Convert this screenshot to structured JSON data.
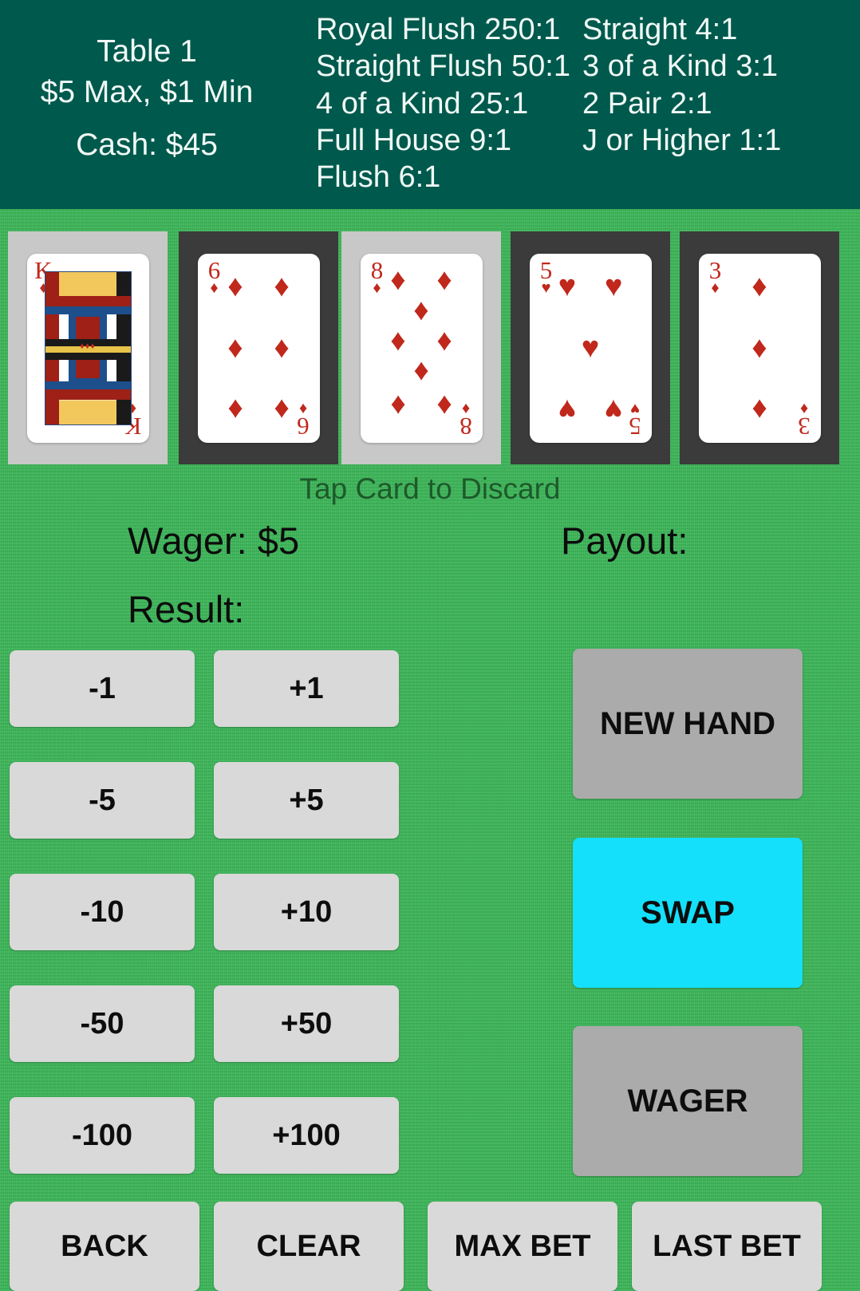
{
  "header": {
    "table_name": "Table 1",
    "limits": "$5 Max, $1 Min",
    "cash": "Cash: $45",
    "paytable_col1": [
      "Royal Flush 250:1",
      "Straight Flush 50:1",
      "4 of a Kind 25:1",
      "Full House 9:1",
      "Flush 6:1"
    ],
    "paytable_col2": [
      "Straight 4:1",
      "3 of a Kind 3:1",
      "2 Pair 2:1",
      "J or Higher 1:1"
    ]
  },
  "hand": {
    "cards": [
      {
        "rank": "K",
        "suit": "diamonds",
        "suit_glyph": "♦",
        "pips": 0,
        "is_court": true,
        "selected": false
      },
      {
        "rank": "6",
        "suit": "diamonds",
        "suit_glyph": "♦",
        "pips": 6,
        "is_court": false,
        "selected": true
      },
      {
        "rank": "8",
        "suit": "diamonds",
        "suit_glyph": "♦",
        "pips": 8,
        "is_court": false,
        "selected": false
      },
      {
        "rank": "5",
        "suit": "hearts",
        "suit_glyph": "♥",
        "pips": 5,
        "is_court": false,
        "selected": true
      },
      {
        "rank": "3",
        "suit": "diamonds",
        "suit_glyph": "♦",
        "pips": 3,
        "is_court": false,
        "selected": true
      }
    ],
    "hint": "Tap Card to Discard"
  },
  "status": {
    "wager": "Wager: $5",
    "payout": "Payout:",
    "result": "Result:"
  },
  "bet_buttons": {
    "minus": [
      "-1",
      "-5",
      "-10",
      "-50",
      "-100"
    ],
    "plus": [
      "+1",
      "+5",
      "+10",
      "+50",
      "+100"
    ]
  },
  "actions": {
    "new_hand": "NEW HAND",
    "swap": "SWAP",
    "wager": "WAGER"
  },
  "bottom": {
    "back": "BACK",
    "clear": "CLEAR",
    "max_bet": "MAX BET",
    "last_bet": "LAST BET"
  },
  "colors": {
    "header_bg": "#00594d",
    "felt_green": "#3cb558",
    "card_slot_unselected": "#c8c8c8",
    "card_slot_selected": "#3b3b3b",
    "button_gray": "#d9d9d9",
    "action_gray": "#ababab",
    "swap_cyan": "#14e0fb",
    "suit_red": "#c0281c",
    "hint_text": "#1d5a2b"
  }
}
